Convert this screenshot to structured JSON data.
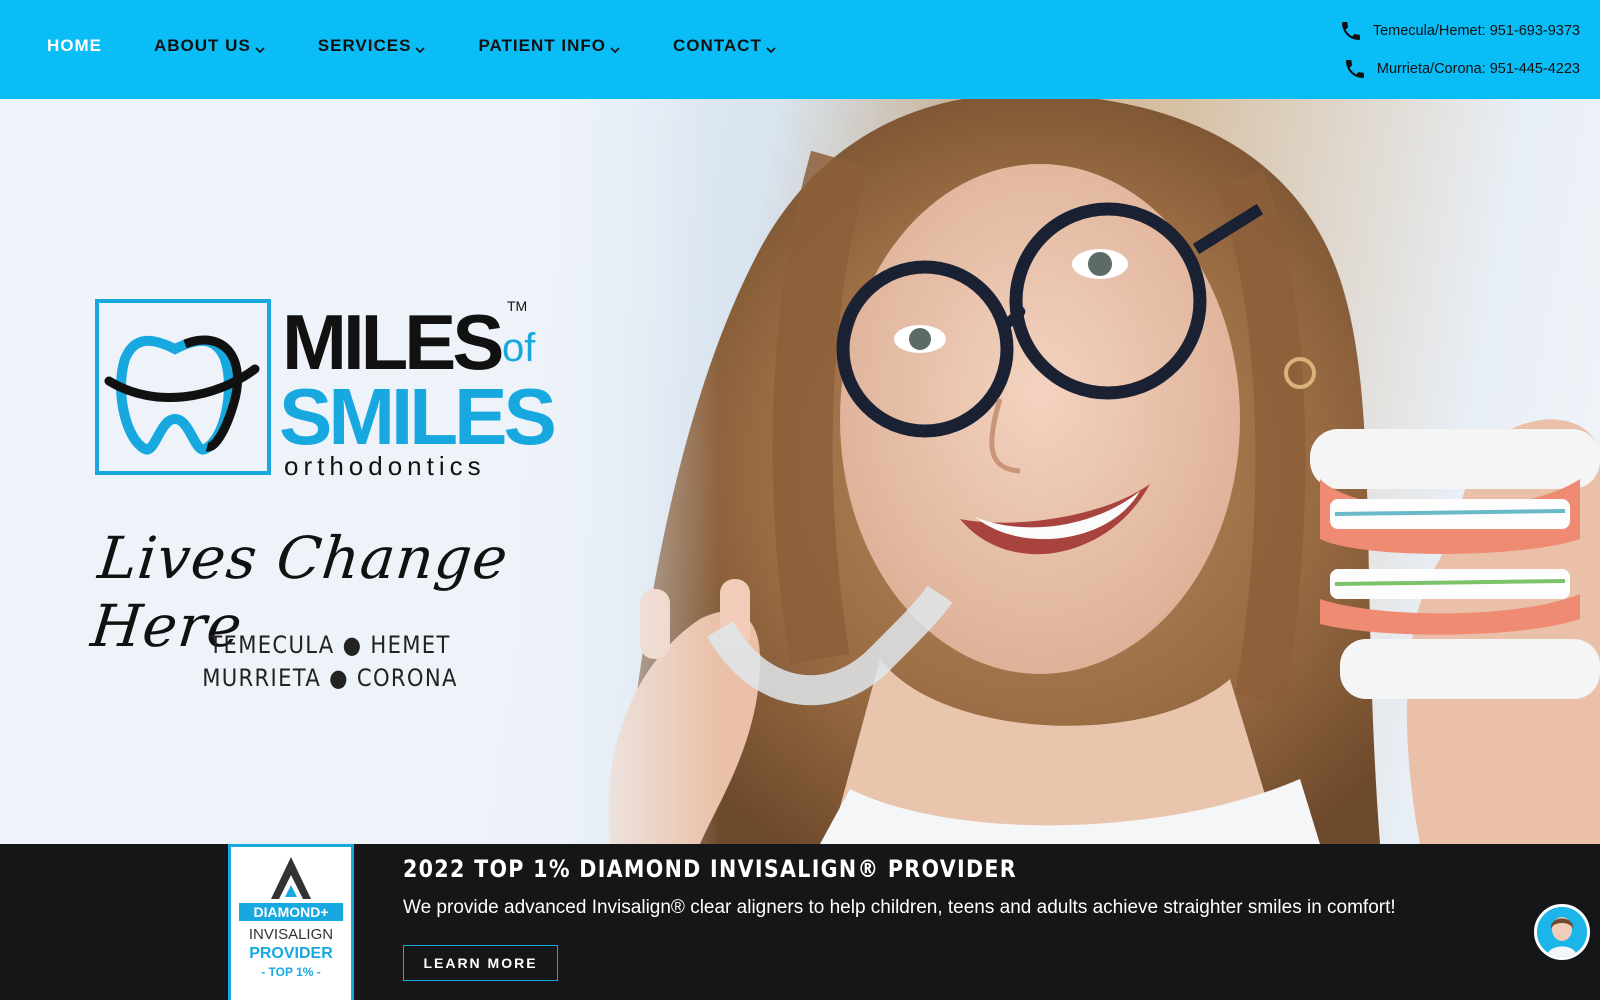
{
  "nav": {
    "items": [
      {
        "label": "HOME",
        "active": true,
        "has_dropdown": false
      },
      {
        "label": "ABOUT US",
        "active": false,
        "has_dropdown": true
      },
      {
        "label": "SERVICES",
        "active": false,
        "has_dropdown": true
      },
      {
        "label": "PATIENT INFO",
        "active": false,
        "has_dropdown": true
      },
      {
        "label": "CONTACT",
        "active": false,
        "has_dropdown": true
      }
    ]
  },
  "phones": [
    {
      "label": "Temecula/Hemet: 951-693-9373",
      "icon": "phone-icon"
    },
    {
      "label": "Murrieta/Corona: 951-445-4223",
      "icon": "phone-icon"
    }
  ],
  "hero": {
    "logo": {
      "line1": "MILES",
      "of": "of",
      "line2": "SMILES",
      "sub": "orthodontics",
      "tm": "TM"
    },
    "tagline": "Lives Change Here",
    "cities_line1": "TEMECULA ● HEMET",
    "cities_line2": "MURRIETA ● CORONA"
  },
  "banner": {
    "badge": {
      "line1": "DIAMOND+",
      "line2": "INVISALIGN",
      "line3": "PROVIDER",
      "line4": "- TOP 1% -"
    },
    "title": "2022 TOP 1% DIAMOND INVISALIGN® PROVIDER",
    "text": "We provide advanced Invisalign® clear aligners to help children, teens and adults achieve straighter smiles in comfort!",
    "button_label": "LEARN MORE"
  },
  "colors": {
    "accent": "#0bbdf6",
    "brand_blue": "#17a8e0",
    "banner_bg": "#141617"
  }
}
